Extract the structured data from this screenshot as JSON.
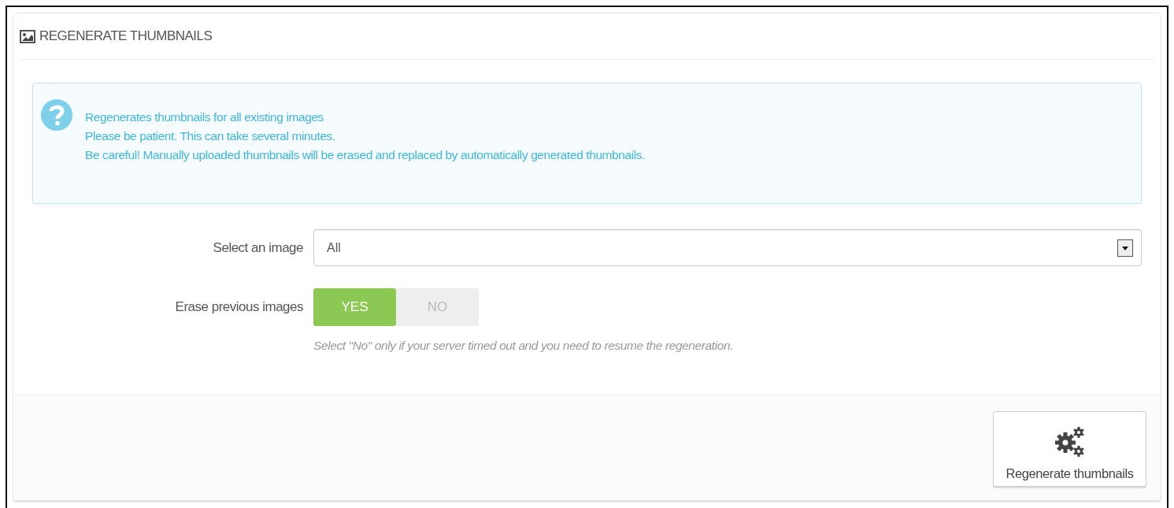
{
  "panel": {
    "title": "REGENERATE THUMBNAILS"
  },
  "alert": {
    "lines": [
      "Regenerates thumbnails for all existing images",
      "Please be patient. This can take several minutes.",
      "Be careful! Manually uploaded thumbnails will be erased and replaced by automatically generated thumbnails."
    ]
  },
  "form": {
    "rows": [
      {
        "kind": "select",
        "label": "Select an image",
        "value": "All"
      },
      {
        "kind": "switch",
        "label": "Erase previous images",
        "options": [
          {
            "label": "YES",
            "selected": true
          },
          {
            "label": "NO",
            "selected": false
          }
        ],
        "help": "Select \"No\" only if your server timed out and you need to resume the regeneration."
      }
    ]
  },
  "footer": {
    "button": "Regenerate thumbnails"
  }
}
